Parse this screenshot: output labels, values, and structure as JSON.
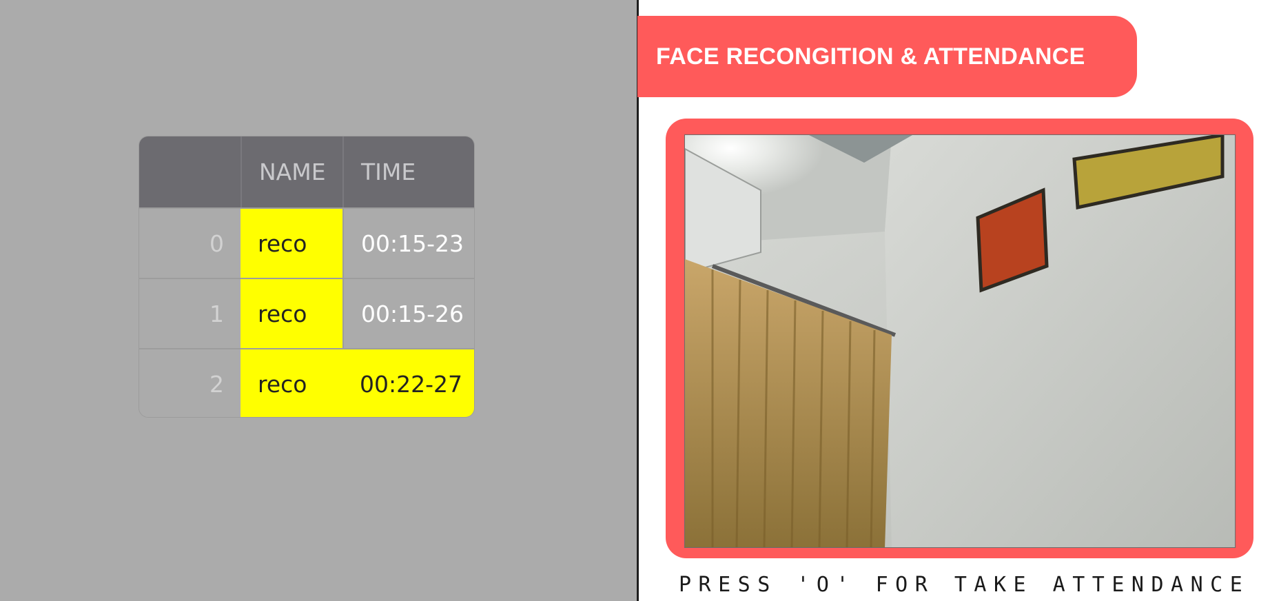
{
  "colors": {
    "accent": "#ff5a5a",
    "left_pane_bg": "#ababab",
    "header_bg": "#6c6b70",
    "highlight": "#ffff00"
  },
  "header": {
    "title": "FACE RECONGITION & ATTENDANCE"
  },
  "attendance_table": {
    "columns": [
      "",
      "NAME",
      "TIME"
    ],
    "rows": [
      {
        "index": "0",
        "name": "reco",
        "time": "00:15-23",
        "highlight_name": true,
        "highlight_time": false
      },
      {
        "index": "1",
        "name": "reco",
        "time": "00:15-26",
        "highlight_name": true,
        "highlight_time": false
      },
      {
        "index": "2",
        "name": "reco",
        "time": "00:22-27",
        "highlight_name": true,
        "highlight_time": true
      }
    ]
  },
  "camera": {
    "description_icon": "webcam-feed"
  },
  "footer": {
    "instruction": "PRESS 'O' FOR TAKE ATTENDANCE"
  }
}
